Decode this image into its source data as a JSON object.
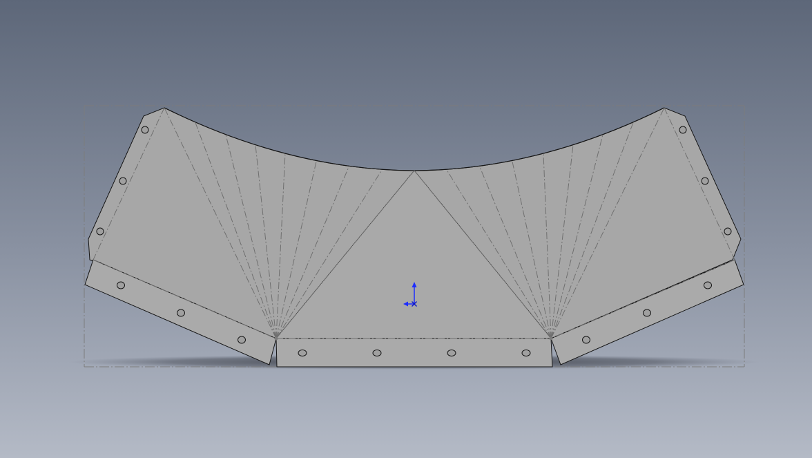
{
  "window": {
    "view": "cad-graphics-area"
  },
  "colors": {
    "background_top": "#5d6779",
    "background_bottom": "#b4bac6",
    "sheet_fill": "#a5a5a5",
    "sheet_fill_light": "#b1b1b1",
    "edge": "#151515",
    "bend_line": "#6f6f6f",
    "bounding_box": "#7c7c7c",
    "shadow": "#2c2f36",
    "triad_y": "#1d2dff",
    "triad_x": "#1d2dff",
    "triad_origin": "#0a14c8"
  },
  "part": {
    "name": "flat-pattern",
    "holes": 16,
    "bend_fans": 2
  },
  "triad": {
    "icon": "coordinate-triad-icon",
    "axes": [
      "y-axis",
      "x-axis"
    ]
  }
}
